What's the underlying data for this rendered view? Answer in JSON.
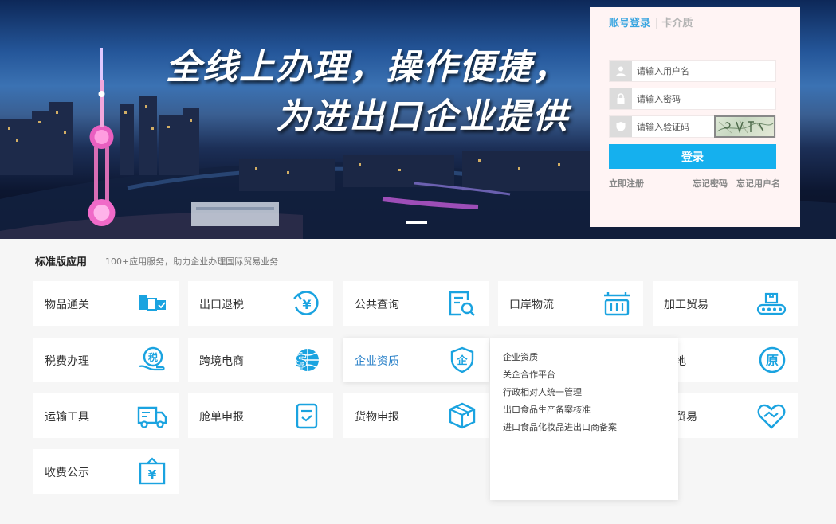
{
  "banner": {
    "line1": "全线上办理，操作便捷，",
    "line2": "为进出口企业提供"
  },
  "login": {
    "tab_account": "账号登录",
    "tab_separator": "|",
    "tab_card": "卡介质",
    "username_placeholder": "请输入用户名",
    "password_placeholder": "请输入密码",
    "captcha_placeholder": "请输入验证码",
    "submit_label": "登录",
    "register_link": "立即注册",
    "forgot_password_link": "忘记密码",
    "forgot_username_link": "忘记用户名"
  },
  "section": {
    "title": "标准版应用",
    "subtitle": "100+应用服务，助力企业办理国际贸易业务"
  },
  "tiles": [
    {
      "label": "物品通关",
      "icon": "parcels-icon"
    },
    {
      "label": "出口退税",
      "icon": "yuan-refund-icon"
    },
    {
      "label": "公共查询",
      "icon": "document-search-icon"
    },
    {
      "label": "口岸物流",
      "icon": "crane-icon"
    },
    {
      "label": "加工贸易",
      "icon": "conveyor-icon"
    },
    {
      "label": "税费办理",
      "icon": "tax-hand-icon"
    },
    {
      "label": "跨境电商",
      "icon": "dollar-globe-icon"
    },
    {
      "label": "企业资质",
      "icon": "shield-company-icon"
    },
    {
      "label": "产地",
      "icon": "origin-icon"
    },
    {
      "label": "运输工具",
      "icon": "truck-icon"
    },
    {
      "label": "舱单申报",
      "icon": "manifest-icon"
    },
    {
      "label": "货物申报",
      "icon": "cargo-box-icon"
    },
    {
      "label": "务贸易",
      "icon": "handshake-icon"
    },
    {
      "label": "收费公示",
      "icon": "fee-board-icon"
    }
  ],
  "dropdown": {
    "items": [
      "企业资质",
      "关企合作平台",
      "行政相对人统一管理",
      "出口食品生产备案核准",
      "进口食品化妆品进出口商备案"
    ]
  },
  "colors": {
    "accent": "#15b0ee",
    "icon_blue": "#1aa3e0",
    "tab_active": "#3aa5e0"
  }
}
